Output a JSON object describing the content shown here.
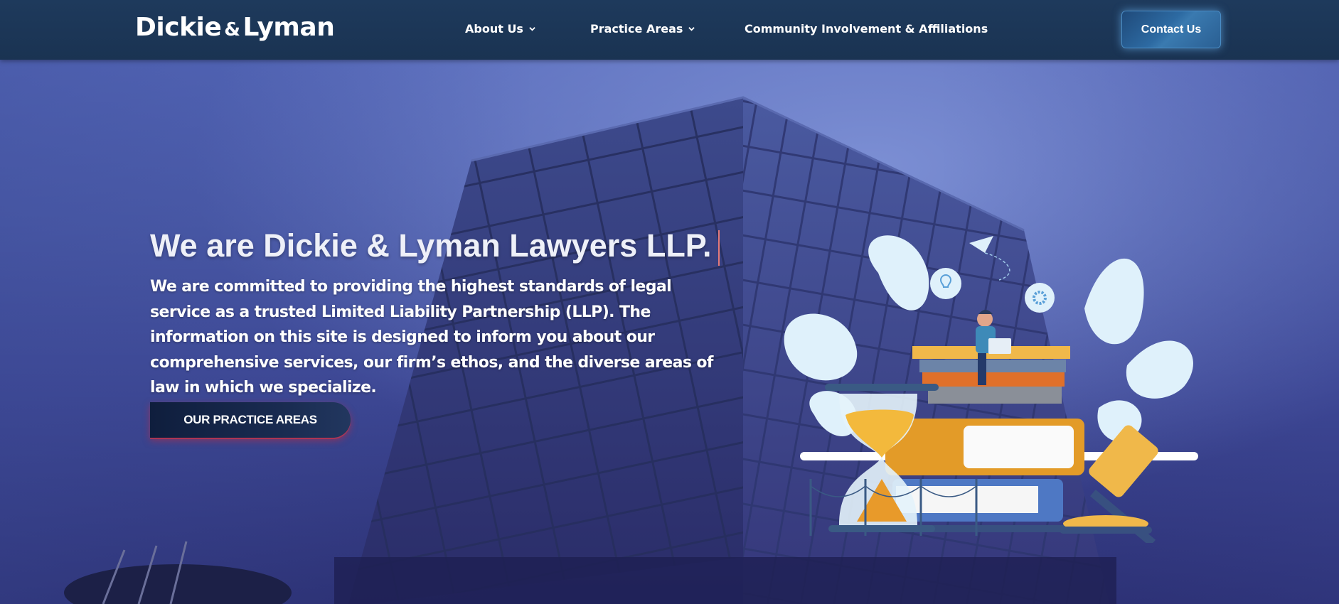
{
  "header": {
    "logo": {
      "part1": "Dickie",
      "amp": "&",
      "part2": "Lyman"
    },
    "nav": [
      {
        "label": "About Us",
        "has_dropdown": true,
        "icon": "chevron-down-icon"
      },
      {
        "label": "Practice Areas",
        "has_dropdown": true,
        "icon": "chevron-down-icon"
      },
      {
        "label": "Community Involvement & Affiliations",
        "has_dropdown": false
      }
    ],
    "contact_label": "Contact Us"
  },
  "hero": {
    "title": "We are Dickie & Lyman Lawyers LLP.",
    "description": "We are committed to providing the highest standards of legal service as a trusted Limited Liability Partnership (LLP). The information on this site is designed to inform you about our comprehensive services, our firm’s ethos, and the diverse areas of law in which we specialize.",
    "cta_label": "OUR PRACTICE AREAS",
    "illustration_icons": [
      "paper-plane-icon",
      "lightbulb-icon",
      "gear-icon",
      "hourglass-icon",
      "books-icon",
      "gavel-icon",
      "laptop-icon"
    ]
  },
  "colors": {
    "header_bg": "#1e3a5c",
    "hero_bg": "#4a5aa8",
    "cta_bg": "#1a2c52",
    "cta_glow": "#d03040",
    "contact_btn": "#2d6aa2",
    "cursor": "#e47a7a"
  }
}
